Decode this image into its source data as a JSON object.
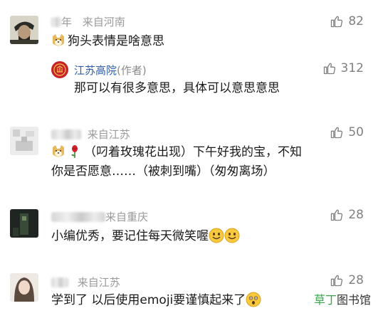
{
  "comments": [
    {
      "name_suffix": "年",
      "location": "来自河南",
      "likes": "82",
      "text": "狗头表情是啥意思",
      "reply": {
        "name": "江苏高院",
        "author_tag": "(作者)",
        "likes": "312",
        "text": "那可以有很多意思，具体可以意思意思"
      }
    },
    {
      "name_suffix": "",
      "location": "来自江苏",
      "likes": "50",
      "text_line1": "（叼着玫瑰花出现）下午好我的宝，不知",
      "text_line2": "你是否愿意……（被刺到嘴）（匆匆离场）"
    },
    {
      "name_suffix": "来自重庆",
      "location": "",
      "likes": "28",
      "text": "小编优秀，要记住每天微笑喔"
    },
    {
      "name_suffix": "",
      "location": "来自江苏",
      "likes": "28",
      "text": "学到了 以后使用emoji要谨慎起来了"
    }
  ],
  "watermark": {
    "green": "草丁",
    "rest": "图书馆"
  },
  "colors": {
    "like_gray": "#808080",
    "name_gray": "#9a9a9a",
    "reply_blue": "#2e5dae",
    "seal_red": "#c7232a",
    "watermark_green": "#3aa64a"
  }
}
